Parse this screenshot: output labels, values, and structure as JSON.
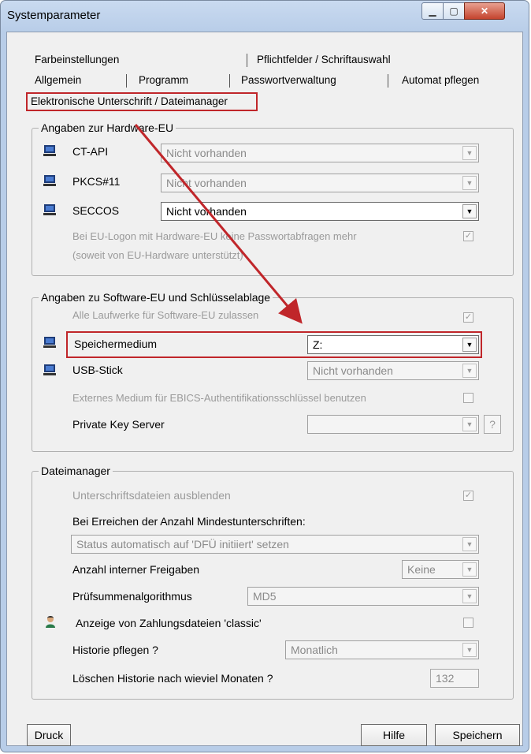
{
  "window": {
    "title": "Systemparameter"
  },
  "tabs": {
    "row1": [
      "Farbeinstellungen",
      "Pflichtfelder / Schriftauswahl"
    ],
    "row2": [
      "Allgemein",
      "Programm",
      "Passwortverwaltung",
      "Automat pflegen"
    ],
    "active": "Elektronische Unterschrift / Dateimanager"
  },
  "hardware": {
    "title": "Angaben zur Hardware-EU",
    "rows": [
      {
        "label": "CT-API",
        "value": "Nicht vorhanden"
      },
      {
        "label": "PKCS#11",
        "value": "Nicht vorhanden"
      },
      {
        "label": "SECCOS",
        "value": "Nicht vorhanden"
      }
    ],
    "logon_note_1": "Bei EU-Logon mit Hardware-EU keine Passwortabfragen mehr",
    "logon_note_2": "(soweit von EU-Hardware unterstützt)"
  },
  "software": {
    "title": "Angaben zu Software-EU und Schlüsselablage",
    "all_drives": "Alle Laufwerke für Software-EU zulassen",
    "storage_label": "Speichermedium",
    "storage_value": "Z:",
    "usb_label": "USB-Stick",
    "usb_value": "Nicht vorhanden",
    "external": "Externes Medium für EBICS-Authentifikationsschlüssel benutzen",
    "pks_label": "Private Key Server",
    "pks_value": "",
    "help_q": "?"
  },
  "filemanager": {
    "title": "Dateimanager",
    "hide_sig": "Unterschriftsdateien ausblenden",
    "min_sig_label": "Bei Erreichen der Anzahl Mindestunterschriften:",
    "min_sig_value": "Status automatisch auf 'DFÜ initiiert' setzen",
    "internal_label": "Anzahl interner Freigaben",
    "internal_value": "Keine",
    "checksum_label": "Prüfsummenalgorithmus",
    "checksum_value": "MD5",
    "classic_label": "Anzeige von Zahlungsdateien 'classic'",
    "history_label": "Historie pflegen ?",
    "history_value": "Monatlich",
    "delete_label": "Löschen Historie nach wieviel Monaten ?",
    "delete_value": "132"
  },
  "buttons": {
    "print": "Druck",
    "help": "Hilfe",
    "save": "Speichern"
  },
  "colors": {
    "highlight": "#c0262a"
  }
}
